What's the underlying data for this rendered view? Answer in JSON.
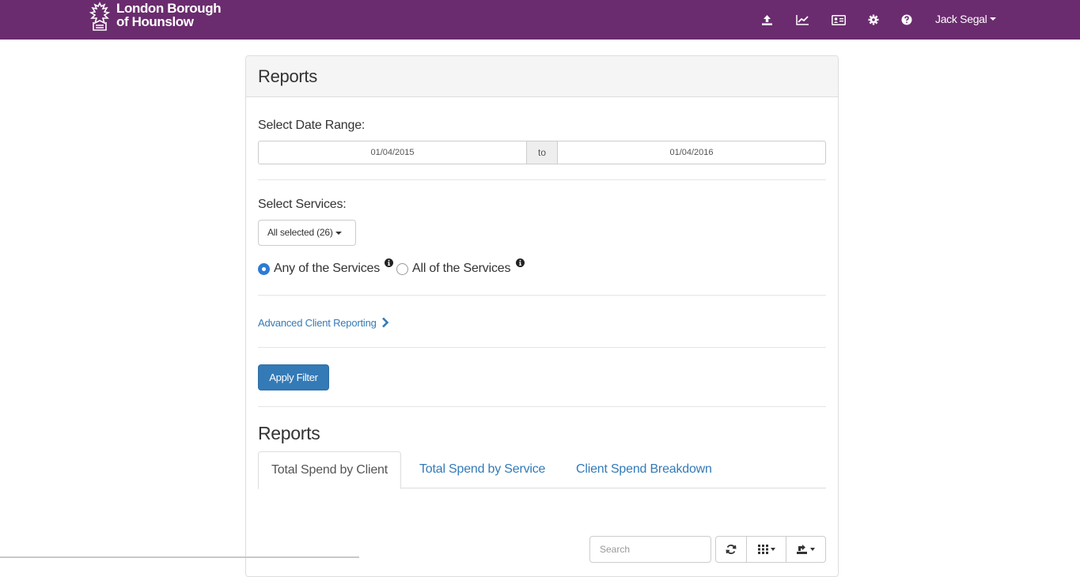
{
  "header": {
    "brand_line1": "London Borough",
    "brand_line2": "of Hounslow",
    "icons": [
      "upload-icon",
      "line-chart-icon",
      "id-card-icon",
      "gear-icon",
      "question-icon"
    ],
    "user_name": "Jack Segal",
    "background_color": "#6a2c6e"
  },
  "panel": {
    "title": "Reports",
    "date_range_label": "Select Date Range:",
    "date_from": "01/04/2015",
    "date_separator": "to",
    "date_to": "01/04/2016",
    "services_label": "Select Services:",
    "services_select": "All selected (26)",
    "radio_any": "Any of the Services",
    "radio_all": "All of the Services",
    "radio_selected": "any",
    "advanced_link": "Advanced Client Reporting",
    "apply_button": "Apply Filter",
    "reports_heading": "Reports",
    "tabs": [
      {
        "label": "Total Spend by Client",
        "active": true
      },
      {
        "label": "Total Spend by Service",
        "active": false
      },
      {
        "label": "Client Spend Breakdown",
        "active": false
      }
    ],
    "search_placeholder": "Search",
    "toolbar_icons": [
      "refresh-icon",
      "columns-grid-icon",
      "export-icon"
    ]
  }
}
